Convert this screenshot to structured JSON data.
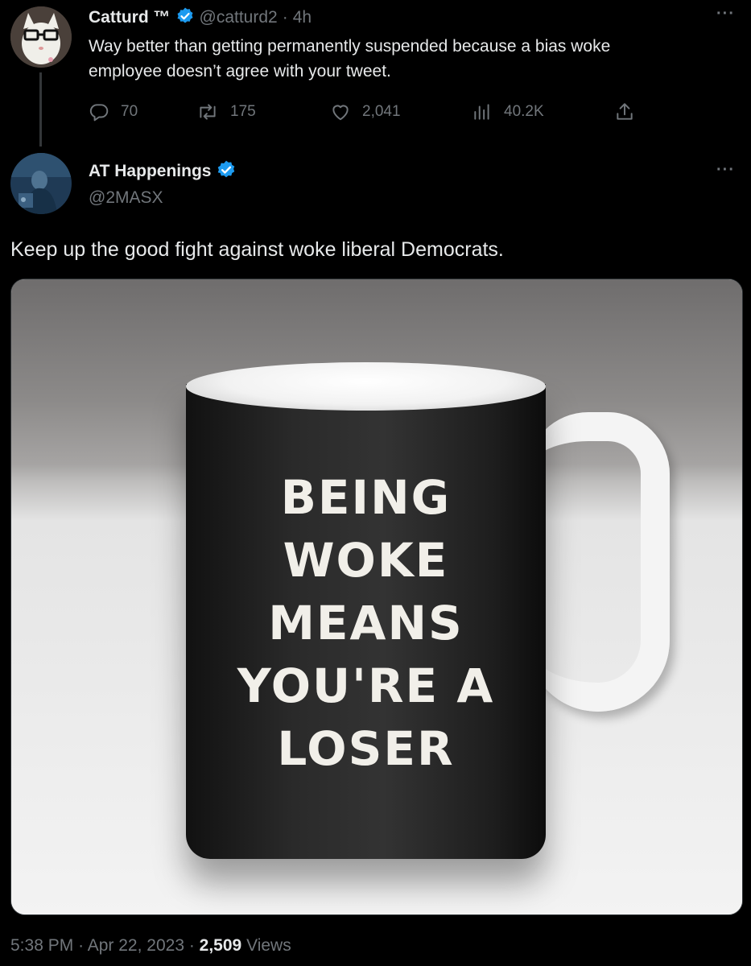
{
  "parent_tweet": {
    "display_name": "Catturd ™",
    "handle": "@catturd2",
    "separator": "·",
    "time_ago": "4h",
    "text_line1": "Way better than getting permanently suspended because a bias woke",
    "text_line2": "employee doesn’t agree with your tweet.",
    "replies": "70",
    "retweets": "175",
    "likes": "2,041",
    "views": "40.2K",
    "more_label": "···"
  },
  "main_tweet": {
    "display_name": "AT Happenings",
    "handle": "@2MASX",
    "more_label": "···",
    "text": "Keep up the good fight against woke liberal Democrats.",
    "image": {
      "mug_lines": [
        "BEING",
        "WOKE",
        "MEANS",
        "YOU'RE A",
        "LOSER"
      ]
    },
    "timestamp_time": "5:38 PM",
    "timestamp_date": "Apr 22, 2023",
    "view_count": "2,509",
    "views_label": "Views"
  },
  "icons": {
    "verified": "verified-badge-icon",
    "reply": "reply-icon",
    "retweet": "retweet-icon",
    "like": "heart-icon",
    "views": "bar-chart-icon",
    "share": "share-icon"
  },
  "colors": {
    "background": "#000000",
    "text": "#e7e9ea",
    "muted": "#71767b",
    "verified": "#1d9bf0"
  }
}
